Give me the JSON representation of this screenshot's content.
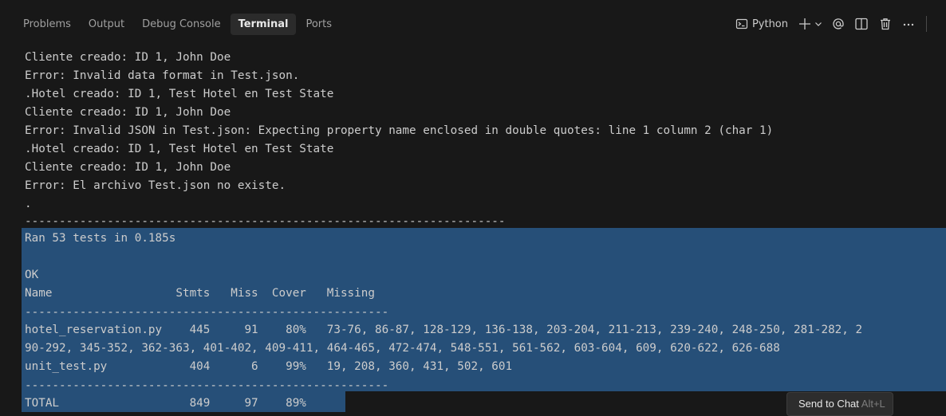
{
  "tabs": [
    {
      "label": "Problems",
      "active": false
    },
    {
      "label": "Output",
      "active": false
    },
    {
      "label": "Debug Console",
      "active": false
    },
    {
      "label": "Terminal",
      "active": true
    },
    {
      "label": "Ports",
      "active": false
    }
  ],
  "actions": {
    "shell_label": "Python",
    "icons": [
      "terminal-icon",
      "plus-icon",
      "chevron-down-icon",
      "at-icon",
      "split-icon",
      "trash-icon",
      "more-icon"
    ]
  },
  "terminal": {
    "lines": [
      "Cliente creado: ID 1, John Doe",
      "Error: Invalid data format in Test.json.",
      ".Hotel creado: ID 1, Test Hotel en Test State",
      "Cliente creado: ID 1, John Doe",
      "Error: Invalid JSON in Test.json: Expecting property name enclosed in double quotes: line 1 column 2 (char 1)",
      ".Hotel creado: ID 1, Test Hotel en Test State",
      "Cliente creado: ID 1, John Doe",
      "Error: El archivo Test.json no existe.",
      ".",
      "----------------------------------------------------------------------",
      "Ran 53 tests in 0.185s",
      "",
      "OK",
      "Name                  Stmts   Miss  Cover   Missing",
      "-----------------------------------------------------",
      "hotel_reservation.py    445     91    80%   73-76, 86-87, 128-129, 136-138, 203-204, 211-213, 239-240, 248-250, 281-282, 2",
      "90-292, 345-352, 362-363, 401-402, 409-411, 464-465, 472-474, 548-551, 561-562, 603-604, 609, 620-622, 626-688",
      "unit_test.py            404      6    99%   19, 208, 360, 431, 502, 601",
      "-----------------------------------------------------",
      "TOTAL                   849     97    89%"
    ]
  },
  "toast": {
    "label": "Send to Chat",
    "shortcut": "Alt+L"
  },
  "colors": {
    "background": "#181818",
    "selection": "#264f78",
    "text": "#cccccc",
    "active_tab_bg": "#2b2b2b"
  }
}
